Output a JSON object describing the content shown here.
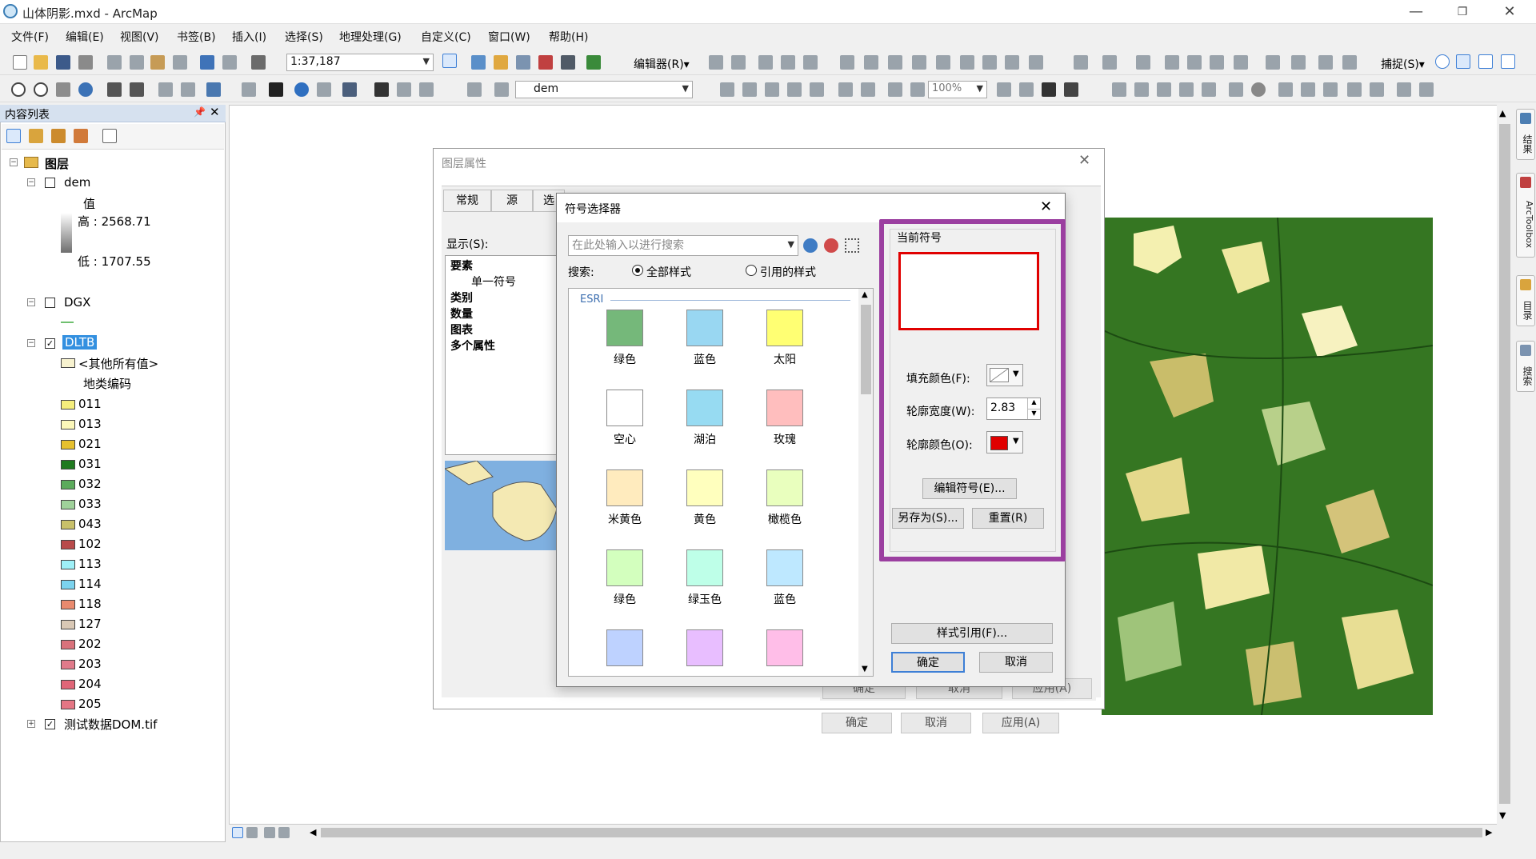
{
  "window": {
    "title": "山体阴影.mxd - ArcMap"
  },
  "menu": [
    "文件(F)",
    "编辑(E)",
    "视图(V)",
    "书签(B)",
    "插入(I)",
    "选择(S)",
    "地理处理(G)",
    "自定义(C)",
    "窗口(W)",
    "帮助(H)"
  ],
  "toolbar": {
    "scale": "1:37,187",
    "editor_label": "编辑器(R)▾",
    "snap_label": "捕捉(S)▾",
    "layer_select": "dem",
    "zoom_percent": "100%"
  },
  "toc": {
    "header": "内容列表",
    "root": "图层",
    "dem": {
      "name": "dem",
      "field": "值",
      "high": "高 : 2568.71",
      "low": "低 : 1707.55"
    },
    "dgx": {
      "name": "DGX"
    },
    "dltb": {
      "name": "DLTB",
      "other": "<其他所有值>",
      "field": "地类编码",
      "classes": [
        {
          "code": "011",
          "color": "#f5ee7c"
        },
        {
          "code": "013",
          "color": "#fbf7b9"
        },
        {
          "code": "021",
          "color": "#e6c02e"
        },
        {
          "code": "031",
          "color": "#1f7a1f"
        },
        {
          "code": "032",
          "color": "#5cab5c"
        },
        {
          "code": "033",
          "color": "#9fd19a"
        },
        {
          "code": "043",
          "color": "#c8c06a"
        },
        {
          "code": "102",
          "color": "#b84a4a"
        },
        {
          "code": "113",
          "color": "#9ef0f7"
        },
        {
          "code": "114",
          "color": "#7cd3ee"
        },
        {
          "code": "118",
          "color": "#e98a6e"
        },
        {
          "code": "127",
          "color": "#d9c8b5"
        },
        {
          "code": "202",
          "color": "#d9727b"
        },
        {
          "code": "203",
          "color": "#e07a8a"
        },
        {
          "code": "204",
          "color": "#e06678"
        },
        {
          "code": "205",
          "color": "#e47684"
        }
      ]
    },
    "dom": {
      "name": "测试数据DOM.tif"
    }
  },
  "right_tabs": [
    "结果",
    "ArcToolbox",
    "目录",
    "搜索"
  ],
  "layer_props": {
    "title": "图层属性",
    "tabs": [
      "常规",
      "源",
      "选"
    ],
    "show_label": "显示(S):",
    "tree": [
      "要素",
      "单一符号",
      "类别",
      "数量",
      "图表",
      "多个属性"
    ],
    "btn_ok": "确定",
    "btn_cancel": "取消",
    "btn_apply": "应用(A)"
  },
  "symbol_selector": {
    "title": "符号选择器",
    "search_placeholder": "在此处输入以进行搜索",
    "search_label": "搜索:",
    "radio_all": "全部样式",
    "radio_ref": "引用的样式",
    "group": "ESRI",
    "swatches": [
      {
        "label": "绿色",
        "color": "#75b87a"
      },
      {
        "label": "蓝色",
        "color": "#99d7f2"
      },
      {
        "label": "太阳",
        "color": "#ffff73"
      },
      {
        "label": "空心",
        "color": "#ffffff"
      },
      {
        "label": "湖泊",
        "color": "#97dbf2"
      },
      {
        "label": "玫瑰",
        "color": "#ffbebe"
      },
      {
        "label": "米黄色",
        "color": "#ffebbe"
      },
      {
        "label": "黄色",
        "color": "#ffffbe"
      },
      {
        "label": "橄榄色",
        "color": "#e9ffbe"
      },
      {
        "label": "绿色",
        "color": "#d3ffbe"
      },
      {
        "label": "绿玉色",
        "color": "#beffe8"
      },
      {
        "label": "蓝色",
        "color": "#bee8ff"
      },
      {
        "label": "",
        "color": "#bed2ff"
      },
      {
        "label": "",
        "color": "#e8beff"
      },
      {
        "label": "",
        "color": "#ffbee8"
      }
    ],
    "current_symbol_label": "当前符号",
    "fill_color_label": "填充颜色(F):",
    "outline_width_label": "轮廓宽度(W):",
    "outline_width_value": "2.83",
    "outline_color_label": "轮廓颜色(O):",
    "outline_color": "#e00000",
    "edit_symbol": "编辑符号(E)...",
    "save_as": "另存为(S)...",
    "reset": "重置(R)",
    "style_refs": "样式引用(F)...",
    "ok": "确定",
    "cancel": "取消",
    "highlight_color": "#9b3fa0"
  }
}
